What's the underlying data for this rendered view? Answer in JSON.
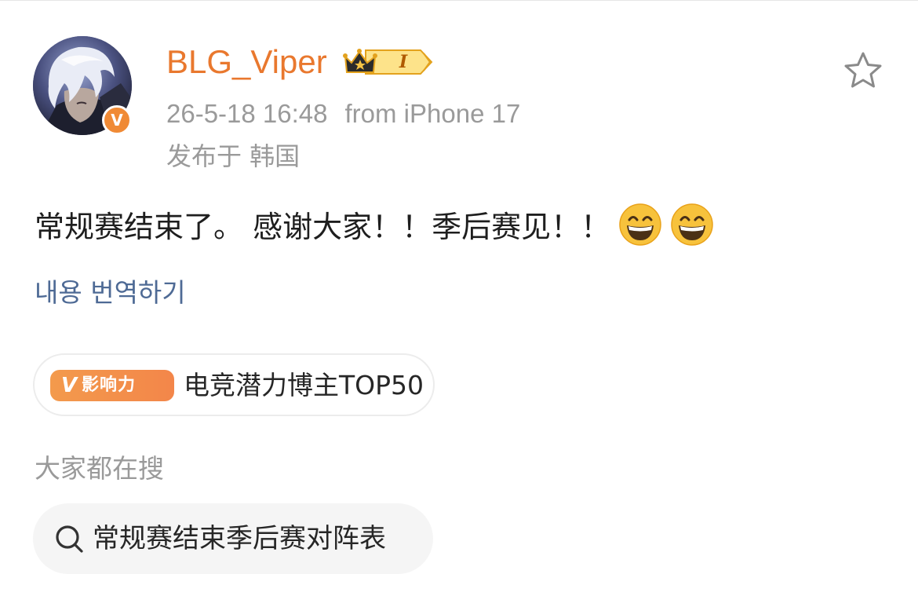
{
  "post": {
    "author": {
      "name": "BLG_Viper",
      "verified_badge": "V",
      "level_label": "I",
      "avatar_icon": "avatar-portrait",
      "name_color": "#e9782e"
    },
    "timestamp": "26-5-18 16:48",
    "source": "from iPhone 17",
    "location": "发布于 韩国",
    "text": "常规赛结束了。 感谢大家！！季后赛见！！",
    "emojis": [
      "grinning-face-icon",
      "grinning-face-icon"
    ],
    "translate_link": "내용 번역하기",
    "favorite_icon": "star-outline-icon"
  },
  "influence": {
    "tag_v": "V",
    "tag_label": "影响力",
    "text": "电竞潜力博主TOP50",
    "tag_color": "#f3864a"
  },
  "trending": {
    "heading": "大家都在搜",
    "search_icon": "search-icon",
    "query": "常规赛结束季后赛对阵表"
  }
}
